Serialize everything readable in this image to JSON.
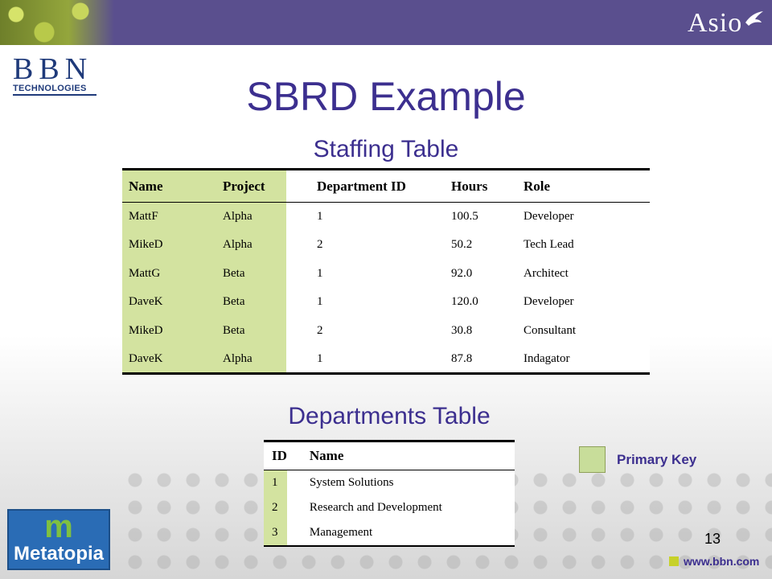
{
  "header": {
    "asio_logo": "Asio",
    "bbn_logo_letters": "BBN",
    "bbn_logo_subtitle": "TECHNOLOGIES"
  },
  "slide": {
    "title": "SBRD Example",
    "page_number": "13"
  },
  "staffing": {
    "title": "Staffing Table",
    "columns": [
      "Name",
      "Project",
      "Department ID",
      "Hours",
      "Role"
    ],
    "rows": [
      [
        "MattF",
        "Alpha",
        "1",
        "100.5",
        "Developer"
      ],
      [
        "MikeD",
        "Alpha",
        "2",
        "50.2",
        "Tech Lead"
      ],
      [
        "MattG",
        "Beta",
        "1",
        "92.0",
        "Architect"
      ],
      [
        "DaveK",
        "Beta",
        "1",
        "120.0",
        "Developer"
      ],
      [
        "MikeD",
        "Beta",
        "2",
        "30.8",
        "Consultant"
      ],
      [
        "DaveK",
        "Alpha",
        "1",
        "87.8",
        "Indagator"
      ]
    ]
  },
  "departments": {
    "title": "Departments Table",
    "columns": [
      "ID",
      "Name"
    ],
    "rows": [
      [
        "1",
        "System Solutions"
      ],
      [
        "2",
        "Research and Development"
      ],
      [
        "3",
        "Management"
      ]
    ]
  },
  "legend": {
    "label": "Primary Key",
    "color": "#c8dd9a"
  },
  "footer": {
    "metatopia_logo": "Metatopia",
    "metatopia_mark": "m",
    "url": "www.bbn.com"
  }
}
